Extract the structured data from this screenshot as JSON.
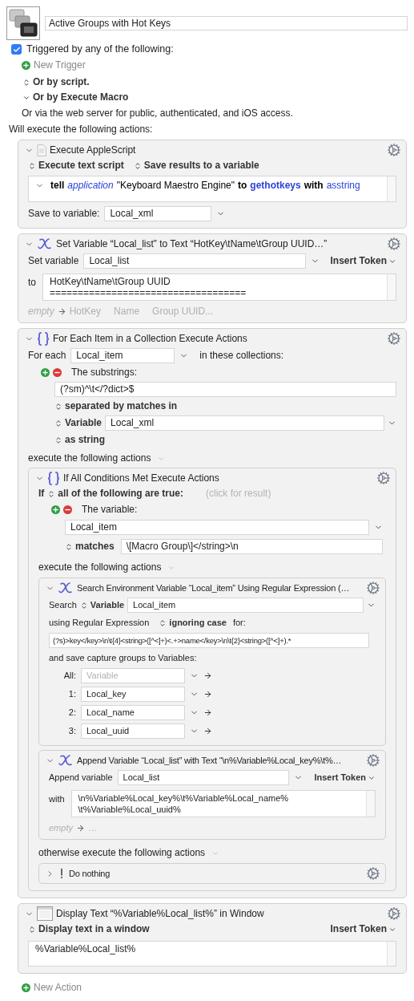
{
  "macro": {
    "title": "Active Groups with Hot Keys"
  },
  "triggers": {
    "checked": true,
    "label": "Triggered by any of the following:",
    "new_trigger": "New Trigger",
    "options": [
      {
        "kind": "popup",
        "label": "Or by script."
      },
      {
        "kind": "disclosure",
        "label": "Or by Execute Macro"
      }
    ],
    "web_note": "Or via the web server for public, authenticated, and iOS access."
  },
  "actions_heading": "Will execute the following actions:",
  "actions": [
    {
      "kind": "applescript",
      "title": "Execute AppleScript",
      "expanded": true,
      "popups": [
        "Execute text script",
        "Save results to a variable"
      ],
      "script": [
        {
          "text": "tell",
          "kind": "keyword"
        },
        {
          "text": "application",
          "kind": "class"
        },
        {
          "text": "\"Keyboard Maestro Engine\"",
          "kind": "string"
        },
        {
          "text": "to",
          "kind": "keyword"
        },
        {
          "text": "gethotkeys",
          "kind": "command"
        },
        {
          "text": "with",
          "kind": "keyword"
        },
        {
          "text": "asstring",
          "kind": "parameter"
        }
      ],
      "save_label": "Save to variable:",
      "variable": "Local_xml"
    },
    {
      "kind": "set_variable",
      "title": "Set Variable “Local_list” to Text “HotKey\\tName\\tGroup UUID…”",
      "expanded": true,
      "field_label": "Set variable",
      "variable": "Local_list",
      "token_menu": "Insert Token",
      "text_label": "to",
      "text": [
        "HotKey\\tName\\tGroup UUID",
        "==================================="
      ],
      "preview_empty": "empty",
      "preview": [
        "HotKey",
        "Name",
        "Group UUID..."
      ]
    },
    {
      "kind": "for_each",
      "title": "For Each Item in a Collection Execute Actions",
      "expanded": true,
      "for_label": "For each",
      "variable": "Local_item",
      "collections_label": "in these collections:",
      "collection": {
        "label": "The substrings:",
        "pattern": "(?sm)^\\t</?dict>$",
        "separator": "separated by matches in",
        "source_kind": "Variable",
        "source": "Local_xml",
        "format": "as string"
      },
      "body_label": "execute the following actions",
      "actions": [
        {
          "kind": "if_all",
          "title": "If All Conditions Met Execute Actions",
          "expanded": true,
          "if_label": "If",
          "mode": "all of the following are true:",
          "result_hint": "(click for result)",
          "condition": {
            "label": "The variable:",
            "variable": "Local_item",
            "operator": "matches",
            "value": "\\[Macro Group\\]</string>\\n"
          },
          "then_label": "execute the following actions",
          "then": [
            {
              "kind": "search_variable",
              "title": "Search Environment Variable “Local_item” Using Regular Expression (…",
              "expanded": true,
              "search_label": "Search",
              "source_kind": "Variable",
              "variable": "Local_item",
              "regex_label": "using Regular Expression",
              "case_mode": "ignoring case",
              "for_label": "for:",
              "pattern": "(?s)>key</key>\\n\\t{4}<string>([^<]+)<.+>name</key>\\n\\t{2}<string>([^<]+).*",
              "groups_label": "and save capture groups to Variables:",
              "groups": [
                {
                  "label": "All:",
                  "placeholder": "Variable"
                },
                {
                  "label": "1:",
                  "value": "Local_key"
                },
                {
                  "label": "2:",
                  "value": "Local_name"
                },
                {
                  "label": "3:",
                  "value": "Local_uuid"
                }
              ]
            },
            {
              "kind": "append_variable",
              "title": "Append Variable “Local_list” with Text “\\n%Variable%Local_key%\\t%…",
              "expanded": true,
              "field_label": "Append variable",
              "variable": "Local_list",
              "token_menu": "Insert Token",
              "text_label": "with",
              "text": [
                "\\n%Variable%Local_key%\\t%Variable%Local_name%",
                "\\t%Variable%Local_uuid%"
              ],
              "preview_empty": "empty",
              "preview": [
                "…"
              ]
            }
          ],
          "else_label": "otherwise execute the following actions",
          "else": [
            {
              "kind": "do_nothing",
              "title": "Do nothing",
              "expanded": false
            }
          ]
        }
      ]
    },
    {
      "kind": "display_text",
      "title": "Display Text “%Variable%Local_list%” in Window",
      "expanded": true,
      "mode": "Display text in a window",
      "token_menu": "Insert Token",
      "text": [
        "%Variable%Local_list%"
      ]
    }
  ],
  "new_action": "New Action"
}
